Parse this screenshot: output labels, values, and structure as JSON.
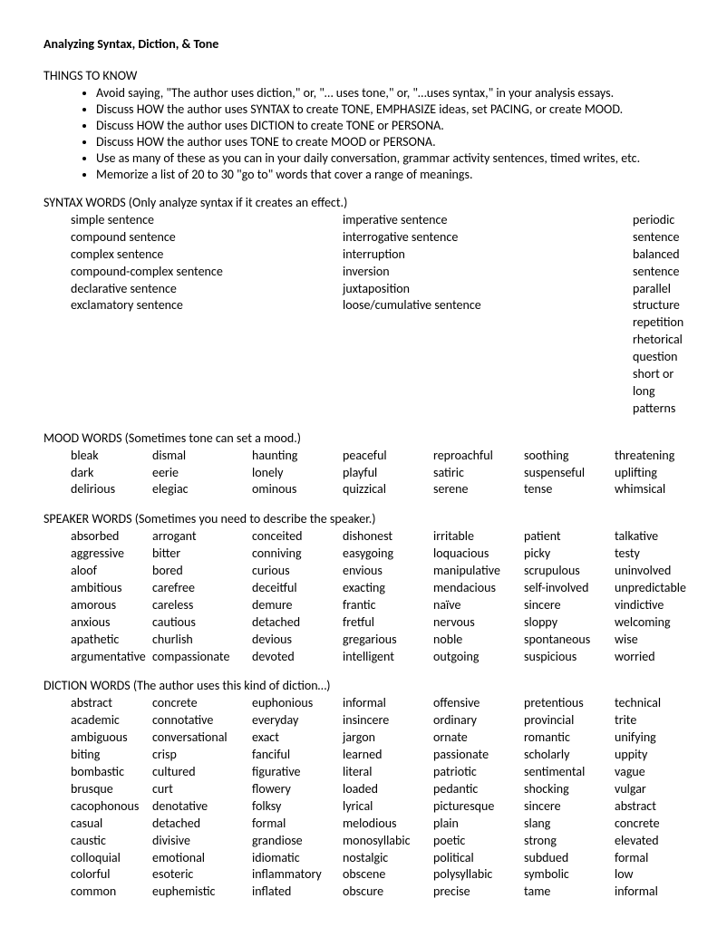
{
  "title": "Analyzing Syntax, Diction, & Tone",
  "things_header": "THINGS TO KNOW",
  "bullets": [
    "Avoid saying, \"The author uses diction,\" or, \"… uses tone,\" or, \"…uses syntax,\" in your analysis essays.",
    "Discuss HOW the author uses SYNTAX to create TONE, EMPHASIZE ideas, set PACING, or create MOOD.",
    "Discuss HOW the author uses DICTION to create TONE or PERSONA.",
    "Discuss HOW the author uses TONE to create MOOD or PERSONA.",
    "Use as many of these as you can in your daily conversation, grammar activity sentences, timed writes, etc.",
    "Memorize a list of 20 to 30 \"go to\" words that cover a range of meanings."
  ],
  "syntax_header": "SYNTAX WORDS (Only analyze syntax if it creates an effect.)",
  "syntax_cols": [
    [
      "simple sentence",
      "compound sentence",
      "complex sentence",
      "compound-complex sentence",
      "declarative sentence",
      "exclamatory sentence"
    ],
    [
      "imperative sentence",
      "interrogative sentence",
      "interruption",
      "inversion",
      "juxtaposition",
      "loose/cumulative sentence"
    ],
    [
      "periodic sentence",
      "balanced sentence",
      "parallel structure",
      "repetition",
      "rhetorical question",
      "short or long patterns"
    ]
  ],
  "mood_header": "MOOD WORDS (Sometimes tone can set a mood.)",
  "mood_cols": [
    [
      "bleak",
      "dark",
      "delirious"
    ],
    [
      "dismal",
      "eerie",
      "elegiac"
    ],
    [
      "haunting",
      "lonely",
      "ominous"
    ],
    [
      "peaceful",
      "playful",
      "quizzical"
    ],
    [
      "reproachful",
      "satiric",
      "serene"
    ],
    [
      "soothing",
      "suspenseful",
      "tense"
    ],
    [
      "threatening",
      "uplifting",
      "whimsical"
    ]
  ],
  "speaker_header": "SPEAKER WORDS (Sometimes you need to describe the speaker.)",
  "speaker_cols": [
    [
      "absorbed",
      "aggressive",
      "aloof",
      "ambitious",
      "amorous",
      "anxious",
      "apathetic",
      "argumentative"
    ],
    [
      "arrogant",
      "bitter",
      "bored",
      "carefree",
      "careless",
      "cautious",
      "churlish",
      "compassionate"
    ],
    [
      "conceited",
      "conniving",
      "curious",
      "deceitful",
      "demure",
      "detached",
      "devious",
      "devoted"
    ],
    [
      "dishonest",
      "easygoing",
      "envious",
      "exacting",
      "frantic",
      "fretful",
      "gregarious",
      "intelligent"
    ],
    [
      "irritable",
      "loquacious",
      "manipulative",
      "mendacious",
      "naïve",
      "nervous",
      "noble",
      "outgoing"
    ],
    [
      "patient",
      "picky",
      "scrupulous",
      "self-involved",
      "sincere",
      "sloppy",
      "spontaneous",
      "suspicious"
    ],
    [
      "talkative",
      "testy",
      "uninvolved",
      "unpredictable",
      "vindictive",
      "welcoming",
      "wise",
      "worried"
    ]
  ],
  "diction_header": "DICTION WORDS (The author uses this kind of diction…)",
  "diction_cols": [
    [
      "abstract",
      "academic",
      "ambiguous",
      "biting",
      "bombastic",
      "brusque",
      "cacophonous",
      "casual",
      "caustic",
      "colloquial",
      "colorful",
      "common"
    ],
    [
      "concrete",
      "connotative",
      "conversational",
      "crisp",
      "cultured",
      "curt",
      "denotative",
      "detached",
      "divisive",
      "emotional",
      "esoteric",
      "euphemistic"
    ],
    [
      "euphonious",
      "everyday",
      "exact",
      "fanciful",
      "figurative",
      "flowery",
      "folksy",
      "formal",
      "grandiose",
      "idiomatic",
      "inflammatory",
      "inflated"
    ],
    [
      "informal",
      "insincere",
      "jargon",
      "learned",
      "literal",
      "loaded",
      "lyrical",
      "melodious",
      "monosyllabic",
      "nostalgic",
      "obscene",
      "obscure"
    ],
    [
      "offensive",
      "ordinary",
      "ornate",
      "passionate",
      "patriotic",
      "pedantic",
      "picturesque",
      "plain",
      "poetic",
      "political",
      "polysyllabic",
      "precise"
    ],
    [
      "pretentious",
      "provincial",
      "romantic",
      "scholarly",
      "sentimental",
      "shocking",
      "sincere",
      "slang",
      "strong",
      "subdued",
      "symbolic",
      "tame"
    ],
    [
      "technical",
      "trite",
      "unifying",
      "uppity",
      "vague",
      "vulgar",
      "abstract",
      "concrete",
      "elevated",
      "formal",
      "low",
      "informal"
    ]
  ]
}
